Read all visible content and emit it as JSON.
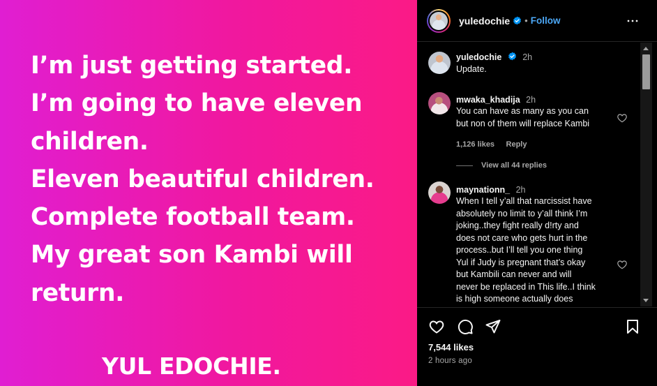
{
  "post": {
    "lines": [
      "I’m just getting started.",
      "I’m going to have eleven",
      "children.",
      "Eleven beautiful children.",
      "Complete football team.",
      "My great son Kambi will",
      "return."
    ],
    "signature": "YUL EDOCHIE."
  },
  "header": {
    "username": "yuledochie",
    "separator": "•",
    "follow_label": "Follow"
  },
  "caption": {
    "username": "yuledochie",
    "time": "2h",
    "text": "Update."
  },
  "comments": [
    {
      "username": "mwaka_khadija",
      "time": "2h",
      "lines": [
        "You can have as many as you can",
        "but non of them will replace Kambi"
      ],
      "likes": "1,126 likes",
      "reply_label": "Reply",
      "view_replies": "View all 44 replies"
    },
    {
      "username": "maynationn_",
      "time": "2h",
      "lines": [
        "When I tell y’all that narcissist have",
        "absolutely no limit to y’all think I’m",
        "joking..they fight really d!rty and",
        "does not care who gets hurt in the",
        "process..but I’ll tell you one thing",
        "Yul if Judy is pregnant that’s okay",
        "but Kambili can never and will",
        "never be replaced in This life..I think",
        "is high someone actually does"
      ]
    }
  ],
  "footer": {
    "likes": "7,544 likes",
    "time_ago": "2 hours ago"
  },
  "icons": {
    "more": "more-horizontal-icon",
    "verified": "verified-badge-icon",
    "like": "heart-icon",
    "comment": "comment-icon",
    "share": "send-icon",
    "save": "bookmark-icon"
  },
  "colors": {
    "accent": "#4ca7f5",
    "gradient_start": "#e01ed2",
    "gradient_end": "#fb1a86",
    "muted_text": "#a8a8a8"
  }
}
